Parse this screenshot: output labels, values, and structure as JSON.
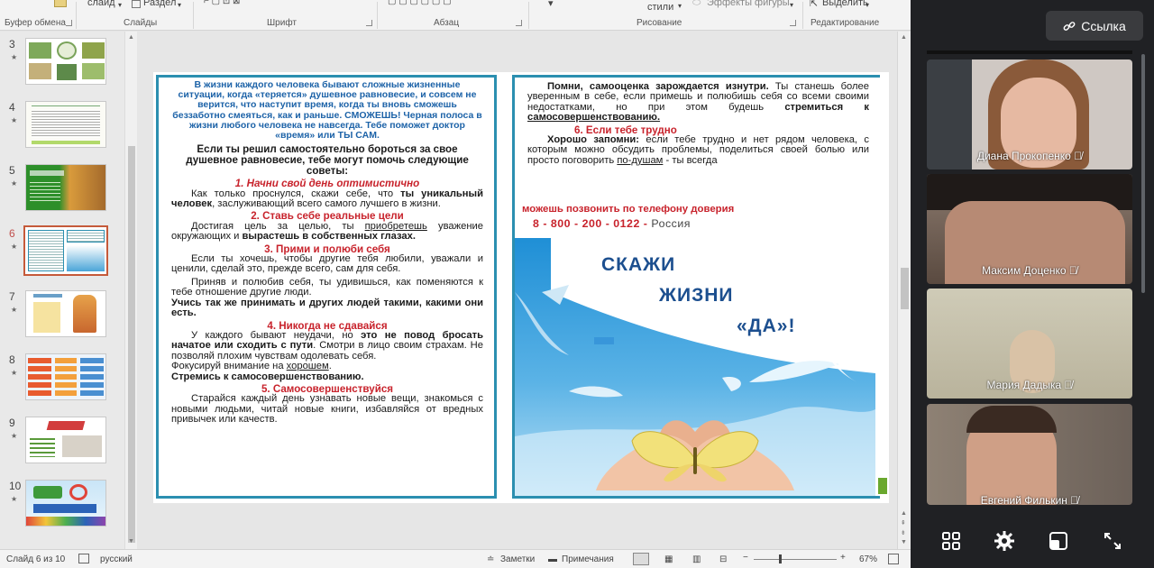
{
  "ribbon": {
    "top_slide_btn": "слайд",
    "top_section_btn": "Раздел",
    "top_styles": "стили",
    "top_shape_effects": "Эффекты фигуры",
    "top_select": "Выделить",
    "groups": [
      "Буфер обмена",
      "Слайды",
      "Шрифт",
      "Абзац",
      "Рисование",
      "Редактирование"
    ]
  },
  "thumbnails": [
    {
      "num": "3",
      "selected": false
    },
    {
      "num": "4",
      "selected": false
    },
    {
      "num": "5",
      "selected": false
    },
    {
      "num": "6",
      "selected": true
    },
    {
      "num": "7",
      "selected": false
    },
    {
      "num": "8",
      "selected": false
    },
    {
      "num": "9",
      "selected": false
    },
    {
      "num": "10",
      "selected": false
    }
  ],
  "slide": {
    "left": {
      "intro": "В жизни каждого человека бывают сложные жизненные ситуации, когда «теряется» душевное равновесие, и совсем не верится, что наступит время, когда ты вновь сможешь беззаботно смеяться, как и раньше. СМОЖЕШЬ! Черная полоса в жизни любого человека не навсегда. Тебе поможет доктор «время» или ТЫ САМ.",
      "lead": "Если ты решил самостоятельно бороться за свое душевное равновесие, тебе могут помочь следующие советы:",
      "h1": "1. Начни свой день оптимистично",
      "p1a": "Как только проснулся, скажи себе, что ",
      "p1b": "ты уникальный человек",
      "p1c": ", заслуживающий всего самого лучшего в жизни.",
      "h2": "2. Ставь себе реальные цели",
      "p2a": "Достигая цель за целью, ты ",
      "p2b": "приобретешь",
      "p2c": " уважение окружающих и ",
      "p2d": "вырастешь в собственных глазах.",
      "h3": "3. Прими и полюби себя",
      "p3": "Если ты хочешь, чтобы другие тебя любили, уважали и ценили, сделай это, прежде всего, сам для себя.",
      "p4": "Приняв и полюбив себя, ты удивишься, как поменяются к тебе отношение другие люди.",
      "p5": "Учись так же принимать и других людей такими, какими они есть.",
      "h4": "4. Никогда не сдавайся",
      "p6a": "У каждого бывают неудачи, но ",
      "p6b": "это не повод бросать начатое или сходить с пути",
      "p6c": ". Смотри в лицо своим страхам. Не позволяй плохим чувствам одолевать себя.",
      "p7a": "Фокусируй внимание на ",
      "p7b": "хорошем",
      "p7c": ".",
      "p8": "Стремись к самосовершенствованию.",
      "h5": "5. Самосовершенствуйся",
      "p9": "Старайся каждый день узнавать новые вещи, знакомься с новыми людьми, читай новые книги, избавляйся от вредных привычек или качеств."
    },
    "right": {
      "r1a": "Помни, самооценка зарождается изнутри.",
      "r1b": " Ты станешь более уверенным в себе, если примешь и полюбишь себя со всеми своими недостатками, но при этом будешь ",
      "r1c": "стремиться к",
      "r1d": " ",
      "r1e": "самосовершенствованию.",
      "h6": "6. Если тебе трудно",
      "r2a": "Хорошо запомни:",
      "r2b": " если тебе трудно и нет рядом человека, с которым можно обсудить проблемы, поделиться своей болью или просто поговорить ",
      "r2c": "по-душам",
      "r2d": " - ты всегда",
      "hotline_intro": "можешь позвонить по телефону доверия",
      "hotline_number": "8 - 800 - 200 - 0122 -",
      "hotline_country": " Россия",
      "poster_line1": "СКАЖИ",
      "poster_line2": "ЖИЗНИ",
      "poster_line3": "«ДА»!"
    }
  },
  "status": {
    "slide_counter": "Слайд 6 из 10",
    "language": "русский",
    "notes": "Заметки",
    "comments": "Примечания",
    "zoom": "67%"
  },
  "meeting": {
    "link_label": "Ссылка",
    "participants": [
      {
        "name": "Диана Прокопенко"
      },
      {
        "name": "Максим Доценко"
      },
      {
        "name": "Мария Дадыка"
      },
      {
        "name": "Евгений Филькин"
      }
    ]
  },
  "colors": {
    "accent_red": "#c8232c",
    "accent_blue": "#1d63a8",
    "frame_teal": "#2b8fb0",
    "selection": "#c55a3a"
  }
}
